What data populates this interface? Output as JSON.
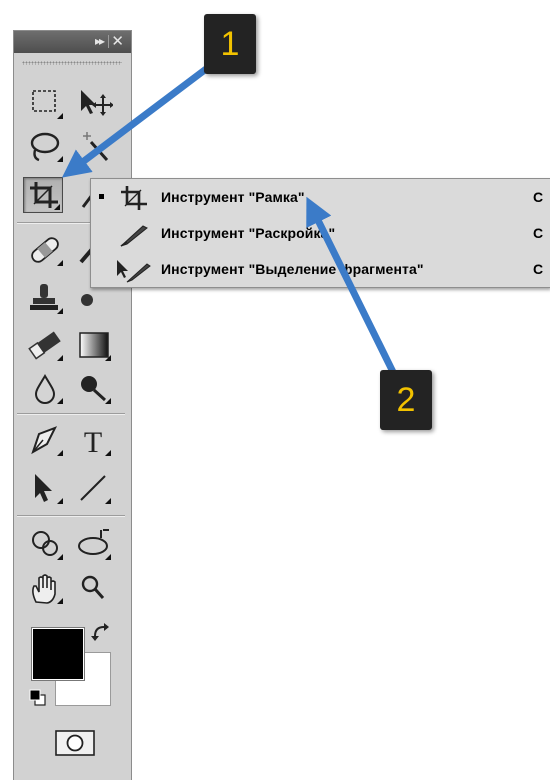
{
  "toolbox": {
    "collapse_glyph": "▸▸",
    "close_glyph": "✕",
    "tools": [
      {
        "name": "rectangular-marquee-tool",
        "icon": "marquee-icon"
      },
      {
        "name": "move-tool",
        "icon": "move-icon"
      },
      {
        "name": "lasso-tool",
        "icon": "lasso-icon"
      },
      {
        "name": "quick-selection-tool",
        "icon": "magic-wand-icon"
      },
      {
        "name": "crop-tool",
        "icon": "crop-icon",
        "active": true
      },
      {
        "name": "eyedropper-tool",
        "icon": "eyedropper-icon"
      },
      {
        "name": "spot-healing-tool",
        "icon": "bandage-icon"
      },
      {
        "name": "brush-tool",
        "icon": "brush-icon"
      },
      {
        "name": "clone-stamp-tool",
        "icon": "stamp-icon"
      },
      {
        "name": "history-brush-tool",
        "icon": "history-brush-icon"
      },
      {
        "name": "eraser-tool",
        "icon": "eraser-icon"
      },
      {
        "name": "gradient-tool",
        "icon": "gradient-icon"
      },
      {
        "name": "blur-tool",
        "icon": "drop-icon"
      },
      {
        "name": "dodge-tool",
        "icon": "dodge-icon"
      },
      {
        "name": "pen-tool",
        "icon": "pen-icon"
      },
      {
        "name": "type-tool",
        "icon": "type-icon",
        "glyph": "T"
      },
      {
        "name": "path-selection-tool",
        "icon": "arrow-icon"
      },
      {
        "name": "line-tool",
        "icon": "line-icon"
      },
      {
        "name": "3d-rotate-tool",
        "icon": "3d-rotate-icon"
      },
      {
        "name": "3d-orbit-tool",
        "icon": "3d-orbit-icon"
      },
      {
        "name": "hand-tool",
        "icon": "hand-icon"
      },
      {
        "name": "zoom-tool",
        "icon": "zoom-icon"
      }
    ],
    "foreground_color": "#000000",
    "background_color": "#ffffff"
  },
  "flyout": {
    "items": [
      {
        "label": "Инструмент \"Рамка\"",
        "shortcut": "C",
        "selected": true,
        "icon": "crop-icon"
      },
      {
        "label": "Инструмент \"Раскройка\"",
        "shortcut": "C",
        "selected": false,
        "icon": "slice-icon"
      },
      {
        "label": "Инструмент \"Выделение фрагмента\"",
        "shortcut": "C",
        "selected": false,
        "icon": "slice-select-icon"
      }
    ]
  },
  "callouts": [
    {
      "number": "1"
    },
    {
      "number": "2"
    }
  ],
  "colors": {
    "arrow": "#3b7bc8",
    "callout_bg": "#232323",
    "callout_text": "#f2c200",
    "panel": "#d2d2d2"
  }
}
